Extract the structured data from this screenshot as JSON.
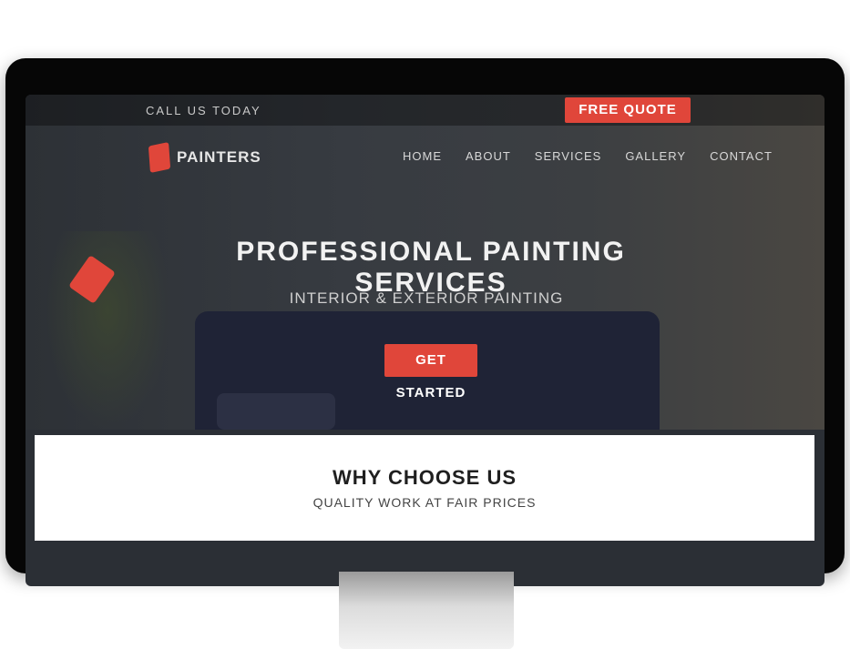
{
  "top_bar": {
    "contact": "CALL US TODAY",
    "cta_label": "FREE QUOTE"
  },
  "logo": {
    "text": "PAINTERS"
  },
  "nav": {
    "items": [
      "HOME",
      "ABOUT",
      "SERVICES",
      "GALLERY",
      "CONTACT"
    ]
  },
  "hero": {
    "headline": "PROFESSIONAL PAINTING SERVICES",
    "subhead": "INTERIOR & EXTERIOR PAINTING",
    "cta_label": "GET STARTED"
  },
  "band": {
    "title": "WHY CHOOSE US",
    "subtitle": "QUALITY WORK AT FAIR PRICES"
  },
  "colors": {
    "accent": "#e0463a",
    "bezel": "#060606"
  }
}
